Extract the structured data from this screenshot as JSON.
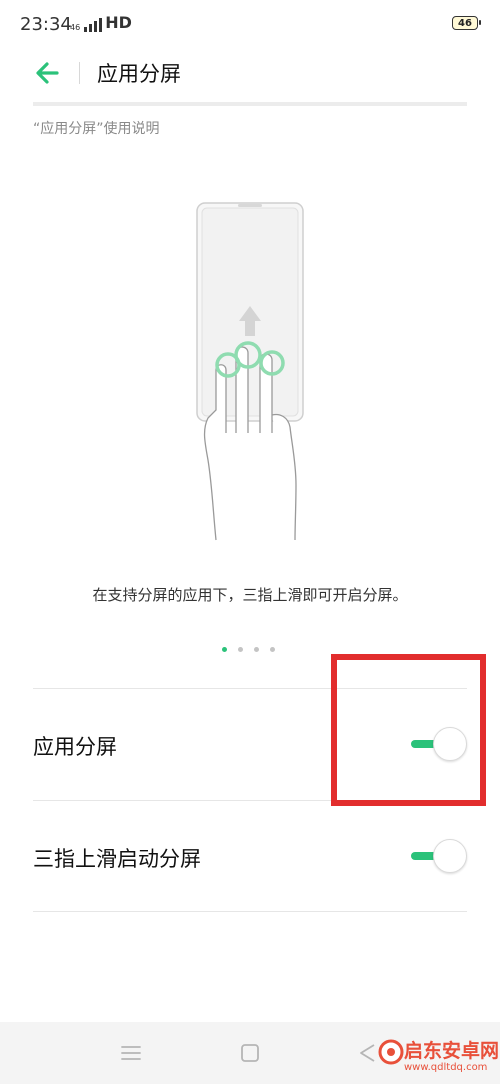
{
  "status_bar": {
    "time": "23:34",
    "network_small": "46",
    "network_hd": "HD",
    "battery": "46"
  },
  "header": {
    "title": "应用分屏"
  },
  "caption": "“应用分屏”使用说明",
  "description": "在支持分屏的应用下，三指上滑即可开启分屏。",
  "carousel": {
    "total": 4,
    "active_index": 0
  },
  "settings": [
    {
      "label": "应用分屏",
      "enabled": true
    },
    {
      "label": "三指上滑启动分屏",
      "enabled": true
    }
  ],
  "watermark": {
    "name": "启东安卓网",
    "url": "www.qdltdq.com"
  },
  "colors": {
    "accent": "#2bc27a",
    "highlight": "#e22d2d"
  },
  "icons": {
    "back": "arrow-left-icon",
    "menu": "menu-icon",
    "home": "square-home-icon",
    "back_nav": "triangle-back-icon"
  }
}
